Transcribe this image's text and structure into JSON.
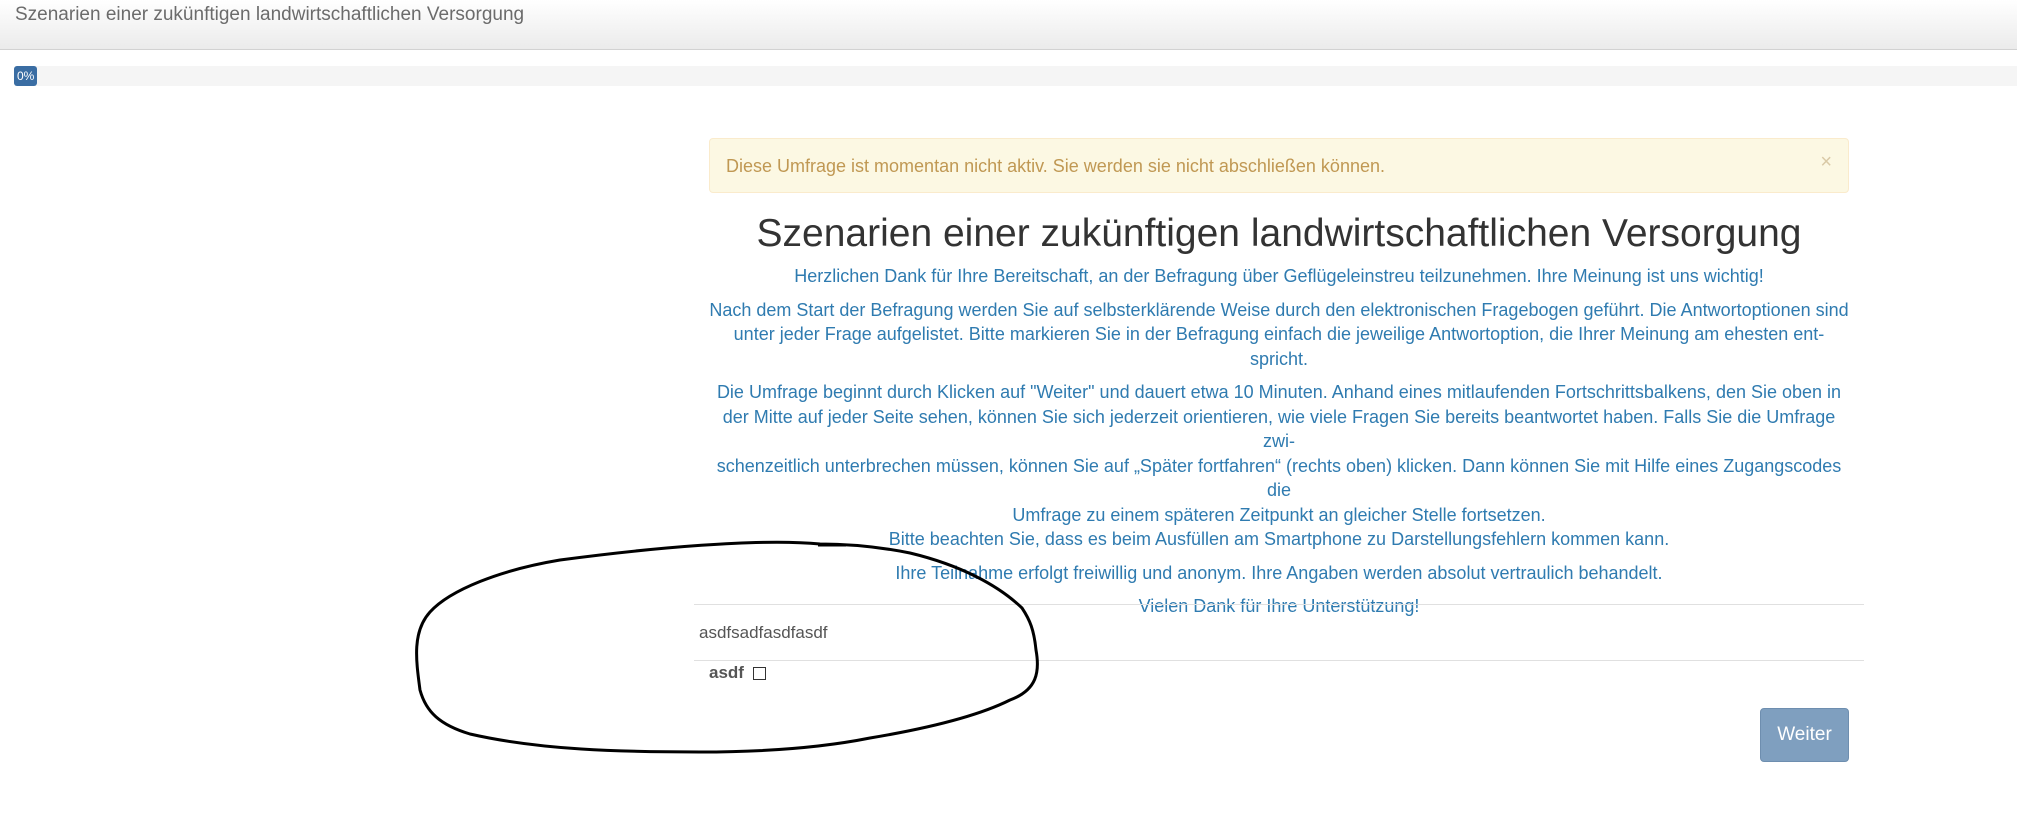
{
  "header": {
    "title": "Szenarien einer zukünftigen landwirtschaftlichen Versorgung"
  },
  "progress": {
    "label": "0%",
    "value": 0
  },
  "alert": {
    "text": "Diese Umfrage ist momentan nicht aktiv. Sie werden sie nicht abschließen können.",
    "close": "×"
  },
  "welcome": {
    "title": "Szenarien einer zukünftigen landwirtschaftlichen Versorgung",
    "p1": "Herzlichen Dank für Ihre Bereitschaft, an der Befragung über Geflügeleinstreu teilzunehmen. Ihre Meinung ist uns wichtig!",
    "p2a": "Nach dem Start der Befragung werden Sie auf selbsterklärende Weise durch den elektronischen Fragebogen geführt. Die Antwortoptionen sind",
    "p2b": "unter jeder Frage aufgelistet. Bitte markieren Sie in der Befragung einfach die jeweilige Antwortoption, die Ihrer Meinung am ehesten ent-",
    "p2c": "spricht.",
    "p3a": "Die Umfrage beginnt durch Klicken auf \"Weiter\" und dauert etwa 10 Minuten. Anhand eines mitlaufenden Fortschrittsbalkens, den Sie oben in",
    "p3b": "der Mitte auf jeder Seite sehen, können Sie sich jederzeit orientieren, wie viele Fragen Sie bereits beantwortet haben. Falls Sie die Umfrage zwi-",
    "p3c": "schenzeitlich unterbrechen müssen, können Sie auf „Später fortfahren“ (rechts oben) klicken. Dann können Sie mit Hilfe eines Zugangscodes die",
    "p3d": "Umfrage zu einem späteren Zeitpunkt an gleicher Stelle fortsetzen.",
    "p3e": "Bitte beachten Sie, dass es beim Ausfüllen am Smartphone zu Darstellungsfehlern kommen kann.",
    "p4": "Ihre Teilnahme erfolgt freiwillig und anonym. Ihre Angaben werden absolut vertraulich behandelt.",
    "p5": "Vielen Dank für Ihre Unterstützung!"
  },
  "question": {
    "text": "asdfsadfasdfasdf",
    "answer_label": "asdf",
    "checked": false
  },
  "buttons": {
    "next": "Weiter"
  },
  "colors": {
    "progress_fill": "#3a6da3",
    "alert_text": "#c09853",
    "alert_bg": "#fcf8e3",
    "welcome_text": "#2f7bb0",
    "button_bg": "#7f9fbf"
  }
}
